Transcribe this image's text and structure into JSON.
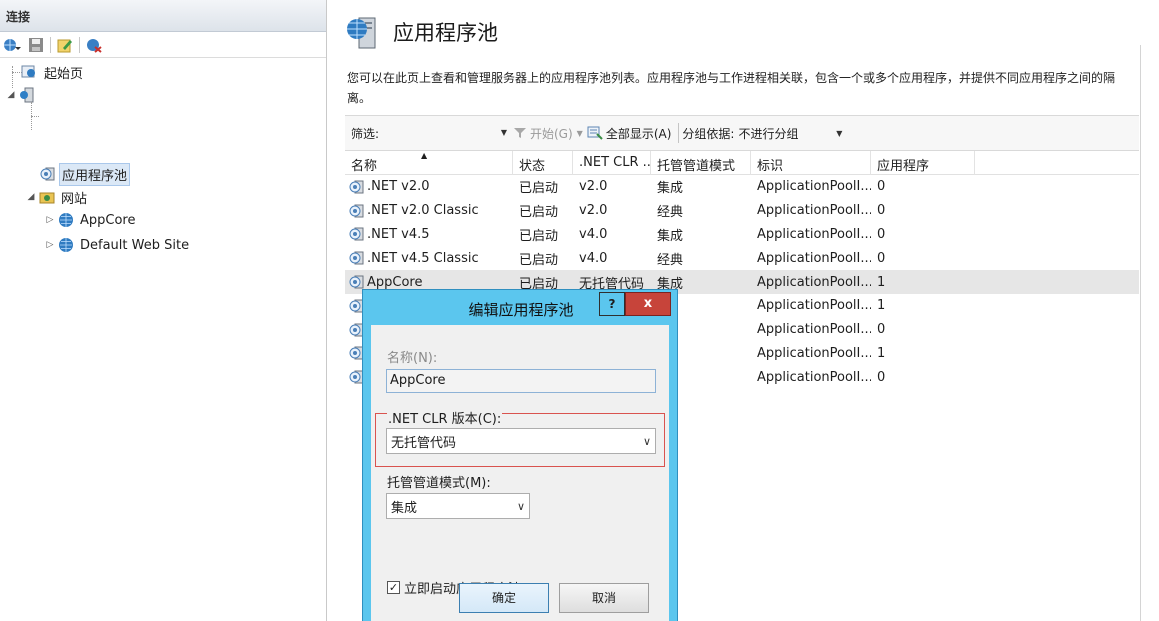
{
  "left_pane": {
    "header": "连接",
    "tree": {
      "start_page": "起始页",
      "server": "",
      "app_pools": "应用程序池",
      "sites": "网站",
      "site_appcore": "AppCore",
      "site_default": "Default Web Site"
    }
  },
  "main": {
    "title": "应用程序池",
    "description": "您可以在此页上查看和管理服务器上的应用程序池列表。应用程序池与工作进程相关联，包含一个或多个应用程序，并提供不同应用程序之间的隔离。",
    "filter": {
      "label": "筛选:",
      "go_label": "开始(G)",
      "show_all_label": "全部显示(A)",
      "group_by_label": "分组依据:",
      "group_by_value": "不进行分组"
    },
    "table": {
      "columns": [
        "名称",
        "状态",
        ".NET CLR ...",
        "托管管道模式",
        "标识",
        "应用程序"
      ],
      "rows": [
        {
          "name": ".NET v2.0",
          "state": "已启动",
          "clr": "v2.0",
          "mode": "集成",
          "identity": "ApplicationPoolI...",
          "apps": "0"
        },
        {
          "name": ".NET v2.0 Classic",
          "state": "已启动",
          "clr": "v2.0",
          "mode": "经典",
          "identity": "ApplicationPoolI...",
          "apps": "0"
        },
        {
          "name": ".NET v4.5",
          "state": "已启动",
          "clr": "v4.0",
          "mode": "集成",
          "identity": "ApplicationPoolI...",
          "apps": "0"
        },
        {
          "name": ".NET v4.5 Classic",
          "state": "已启动",
          "clr": "v4.0",
          "mode": "经典",
          "identity": "ApplicationPoolI...",
          "apps": "0"
        },
        {
          "name": "AppCore",
          "state": "已启动",
          "clr": "无托管代码",
          "mode": "集成",
          "identity": "ApplicationPoolI...",
          "apps": "1"
        },
        {
          "name": "",
          "state": "",
          "clr": "",
          "mode": "成",
          "identity": "ApplicationPoolI...",
          "apps": "1"
        },
        {
          "name": "",
          "state": "",
          "clr": "",
          "mode": "典",
          "identity": "ApplicationPoolI...",
          "apps": "0"
        },
        {
          "name": "",
          "state": "",
          "clr": "",
          "mode": "成",
          "identity": "ApplicationPoolI...",
          "apps": "1"
        },
        {
          "name": "",
          "state": "",
          "clr": "",
          "mode": "成",
          "identity": "ApplicationPoolI...",
          "apps": "0"
        }
      ]
    }
  },
  "dialog": {
    "title": "编辑应用程序池",
    "help": "?",
    "close": "x",
    "name_label": "名称(N):",
    "name_value": "AppCore",
    "clr_label": ".NET CLR 版本(C):",
    "clr_value": "无托管代码",
    "mode_label": "托管管道模式(M):",
    "mode_value": "集成",
    "autostart_label": "立即启动应用程序池(S)",
    "autostart_checked": true,
    "ok": "确定",
    "cancel": "取消"
  }
}
